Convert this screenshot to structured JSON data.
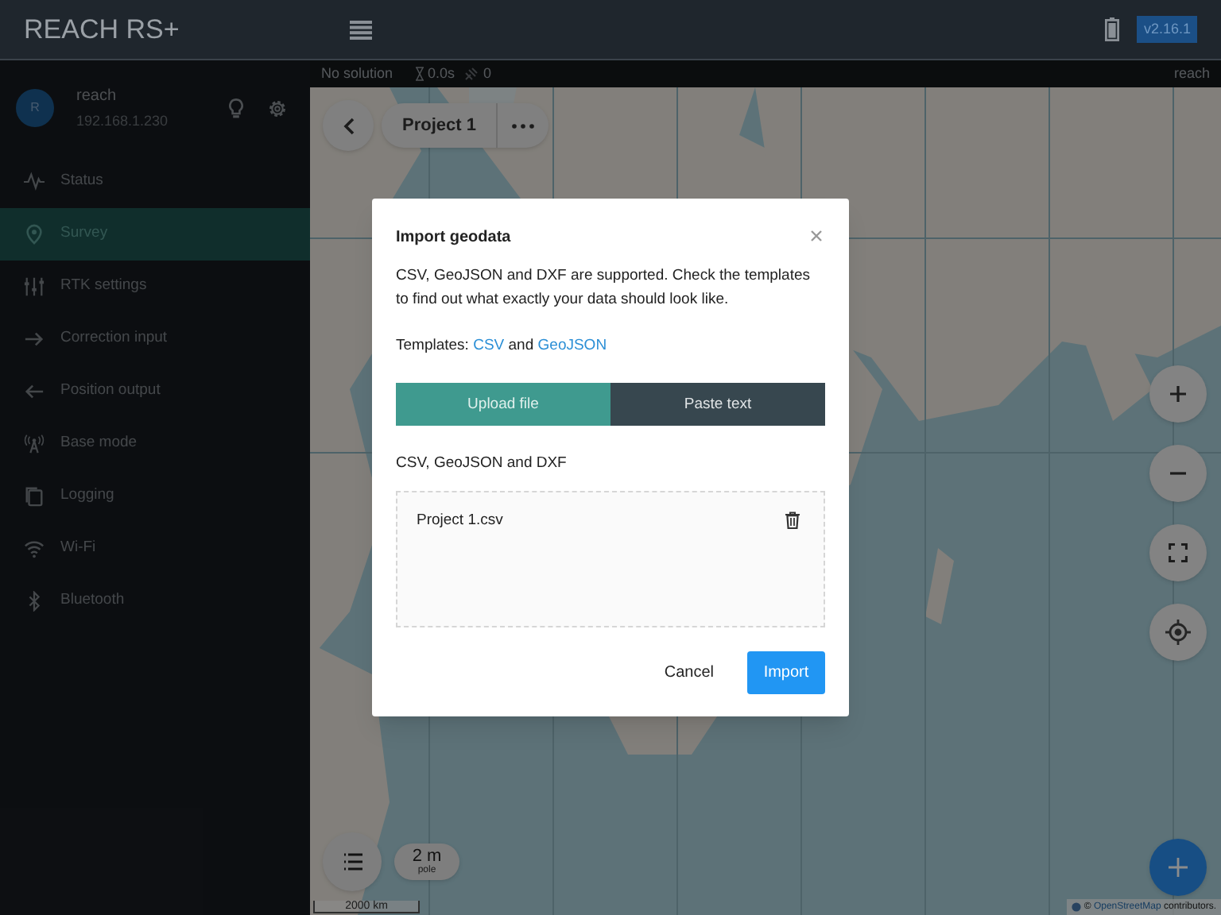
{
  "app": {
    "title": "REACH RS+",
    "version": "v2.16.1"
  },
  "device": {
    "avatar": "R",
    "name": "reach",
    "ip": "192.168.1.230"
  },
  "sidebar": {
    "items": [
      {
        "label": "Status",
        "selected": false
      },
      {
        "label": "Survey",
        "selected": true
      },
      {
        "label": "RTK settings",
        "selected": false
      },
      {
        "label": "Correction input",
        "selected": false
      },
      {
        "label": "Position output",
        "selected": false
      },
      {
        "label": "Base mode",
        "selected": false
      },
      {
        "label": "Logging",
        "selected": false
      },
      {
        "label": "Wi-Fi",
        "selected": false
      },
      {
        "label": "Bluetooth",
        "selected": false
      }
    ]
  },
  "status_bar": {
    "solution": "No solution",
    "age": "0.0s",
    "satellites": "0",
    "device": "reach"
  },
  "project": {
    "name": "Project 1"
  },
  "map": {
    "scale": "2000 km",
    "pole": {
      "height": "2 m",
      "label": "pole"
    },
    "attribution": {
      "prefix": "©",
      "link": "OpenStreetMap",
      "suffix": "contributors."
    }
  },
  "dialog": {
    "title": "Import geodata",
    "description": "CSV, GeoJSON and DXF are supported. Check the templates to find out what exactly your data should look like.",
    "templates": {
      "label": "Templates:",
      "links": [
        "CSV",
        "GeoJSON"
      ],
      "joiner": "and"
    },
    "tabs": [
      {
        "label": "Upload file",
        "selected": true
      },
      {
        "label": "Paste text",
        "selected": false
      }
    ],
    "formats": "CSV, GeoJSON and DXF",
    "files": [
      {
        "name": "Project 1.csv"
      }
    ],
    "buttons": {
      "cancel": "Cancel",
      "import": "Import"
    }
  }
}
